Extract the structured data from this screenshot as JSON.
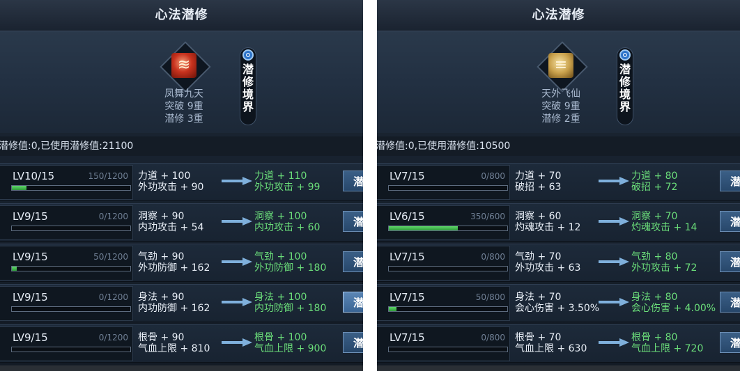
{
  "panels": [
    {
      "title": "心法潜修",
      "skill": {
        "name": "凤舞九天",
        "breakthrough": "突破 9重",
        "cultivation": "潜修 3重",
        "icon": "red-scroll-icon"
      },
      "realm_button": [
        "潜",
        "修",
        "境",
        "界"
      ],
      "points_text": "潜修值:0,已使用潜修值:21100",
      "rows": [
        {
          "level": "LV10/15",
          "progress_text": "150/1200",
          "progress": 0.125,
          "cur1": "力道 + 100",
          "cur2": "外功攻击 + 90",
          "next1": "力道 + 110",
          "next2": "外功攻击 + 99",
          "btn": "潜",
          "highlighted": false
        },
        {
          "level": "LV9/15",
          "progress_text": "0/1200",
          "progress": 0,
          "cur1": "洞察 + 90",
          "cur2": "内功攻击 + 54",
          "next1": "洞察 + 100",
          "next2": "内功攻击 + 60",
          "btn": "潜",
          "highlighted": false
        },
        {
          "level": "LV9/15",
          "progress_text": "50/1200",
          "progress": 0.042,
          "cur1": "气劲 + 90",
          "cur2": "外功防御 + 162",
          "next1": "气劲 + 100",
          "next2": "外功防御 + 180",
          "btn": "潜",
          "highlighted": false
        },
        {
          "level": "LV9/15",
          "progress_text": "0/1200",
          "progress": 0,
          "cur1": "身法 + 90",
          "cur2": "内功防御 + 162",
          "next1": "身法 + 100",
          "next2": "内功防御 + 180",
          "btn": "潜",
          "highlighted": true
        },
        {
          "level": "LV9/15",
          "progress_text": "0/1200",
          "progress": 0,
          "cur1": "根骨 + 90",
          "cur2": "气血上限 + 810",
          "next1": "根骨 + 100",
          "next2": "气血上限 + 900",
          "btn": "潜",
          "highlighted": false
        }
      ]
    },
    {
      "title": "心法潜修",
      "skill": {
        "name": "天外飞仙",
        "breakthrough": "突破 9重",
        "cultivation": "潜修 2重",
        "icon": "gold-scroll-icon"
      },
      "realm_button": [
        "潜",
        "修",
        "境",
        "界"
      ],
      "points_text": "潜修值:0,已使用潜修值:10500",
      "rows": [
        {
          "level": "LV7/15",
          "progress_text": "0/800",
          "progress": 0,
          "cur1": "力道 + 70",
          "cur2": "破招 + 63",
          "next1": "力道 + 80",
          "next2": "破招 + 72",
          "btn": "潜",
          "highlighted": false
        },
        {
          "level": "LV6/15",
          "progress_text": "350/600",
          "progress": 0.583,
          "cur1": "洞察 + 60",
          "cur2": "灼魂攻击 + 12",
          "next1": "洞察 + 70",
          "next2": "灼魂攻击 + 14",
          "btn": "潜",
          "highlighted": false
        },
        {
          "level": "LV7/15",
          "progress_text": "0/800",
          "progress": 0,
          "cur1": "气劲 + 70",
          "cur2": "外功攻击 + 63",
          "next1": "气劲 + 80",
          "next2": "外功攻击 + 72",
          "btn": "潜",
          "highlighted": false
        },
        {
          "level": "LV7/15",
          "progress_text": "50/800",
          "progress": 0.0625,
          "cur1": "身法 + 70",
          "cur2": "会心伤害 + 3.50%",
          "next1": "身法 + 80",
          "next2": "会心伤害 + 4.00%",
          "btn": "潜",
          "highlighted": false
        },
        {
          "level": "LV7/15",
          "progress_text": "0/800",
          "progress": 0,
          "cur1": "根骨 + 70",
          "cur2": "气血上限 + 630",
          "next1": "根骨 + 80",
          "next2": "气血上限 + 720",
          "btn": "潜",
          "highlighted": false
        }
      ]
    }
  ]
}
